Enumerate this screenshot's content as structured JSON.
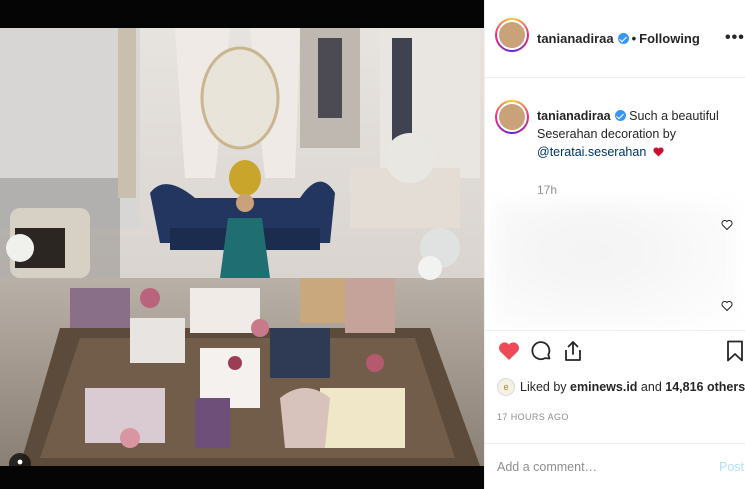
{
  "post": {
    "username": "tanianadiraa",
    "follow_status": "Following",
    "more_label": "•••",
    "separator": "•"
  },
  "caption": {
    "username": "tanianadiraa",
    "text": "Such a beautiful Seserahan decoration by",
    "mention": "@teratai.seserahan",
    "time": "17h"
  },
  "engagement": {
    "liked_by_prefix": "Liked by",
    "liked_by_user": "eminews.id",
    "and_label": "and",
    "others_count": "14,816 others",
    "timestamp": "17 HOURS AGO",
    "liker_avatar_text": "e"
  },
  "comment": {
    "placeholder": "Add a comment…",
    "post_label": "Post"
  },
  "icons": {
    "like": "heart-filled-icon",
    "comment": "comment-icon",
    "share": "share-icon",
    "save": "bookmark-icon",
    "verified": "verified-badge-icon",
    "user_tag": "user-tag-icon"
  },
  "colors": {
    "like_red": "#ed4956",
    "verified_blue": "#3897f0",
    "link_blue": "#003569",
    "post_disabled": "#b2dffc",
    "muted_gray": "#8e8e8e"
  }
}
